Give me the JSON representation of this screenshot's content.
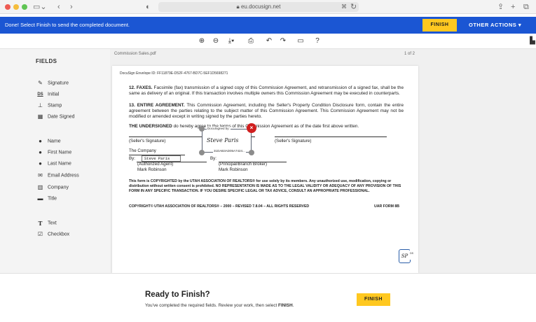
{
  "browser": {
    "url": "eu.docusign.net"
  },
  "banner": {
    "message": "Done! Select Finish to send the completed document.",
    "finish_label": "FINISH",
    "other_actions_label": "OTHER ACTIONS ▾"
  },
  "toolbar": {
    "icons": [
      "zoom-in-icon",
      "zoom-out-icon",
      "download-icon",
      "print-icon",
      "rotate-left-icon",
      "rotate-right-icon",
      "comment-icon",
      "help-icon"
    ]
  },
  "sidebar": {
    "title": "FIELDS",
    "items": [
      {
        "label": "Signature",
        "icon": "signature-icon"
      },
      {
        "label": "Initial",
        "icon": "initial-icon"
      },
      {
        "label": "Stamp",
        "icon": "stamp-icon"
      },
      {
        "label": "Date Signed",
        "icon": "calendar-icon"
      },
      {
        "label": "Name",
        "icon": "person-icon"
      },
      {
        "label": "First Name",
        "icon": "person-icon"
      },
      {
        "label": "Last Name",
        "icon": "person-icon"
      },
      {
        "label": "Email Address",
        "icon": "email-icon"
      },
      {
        "label": "Company",
        "icon": "company-icon"
      },
      {
        "label": "Title",
        "icon": "briefcase-icon"
      },
      {
        "label": "Text",
        "icon": "text-icon"
      },
      {
        "label": "Checkbox",
        "icon": "checkbox-icon"
      }
    ]
  },
  "document": {
    "name": "Commission Sales.pdf",
    "page_count": "1 of 2",
    "envelope_id": "DocuSign Envelope ID: FF11879E-D52F-4767-BD7C-5EF1D5698271",
    "para12_head": "12. FAXES.",
    "para12": "Facsimile (fax) transmission of a signed copy of this Commission Agreement, and retransmission of a signed fax, shall be the same as delivery of an original. If this transaction involves multiple owners this Commission Agreement may be executed in counterparts.",
    "para13_head": "13. ENTIRE AGREEMENT.",
    "para13": "This Commission Agreement, including the Seller's Property Condition Disclosure form, contain the entire agreement between the parties relating to the subject matter of this Commission Agreement. This Commission Agreement may not be modified or amended except in writing signed by the parties hereto.",
    "undersigned_head": "THE UNDERSIGNED",
    "undersigned": "do hereby agree to the terms of this Commission Agreement as of the date first above written.",
    "sellers_signature_left": "(Seller's Signature)",
    "sellers_signature_right": "(Seller's Signature)",
    "company": "The Company",
    "by_left": "By:",
    "by_right": "By:",
    "authorized_agent": "(Authorized Agent)",
    "principal_broker": "(Principal/Branch Broker)",
    "name_left": "Mark Robinson",
    "name_right": "Mark Robinson",
    "legal": "This form is COPYRIGHTED by the UTAH ASSOCIATION OF REALTORS® for use solely by its members. Any unauthorized use, modification, copying or distribution without written consent is prohibited. NO REPRESENTATION IS MADE AS TO THE LEGAL VALIDITY OR ADEQUACY OF ANY PROVISION OF THIS FORM IN ANY SPECIFIC TRANSACTION. IF YOU DESIRE SPECIFIC LEGAL OR TAX ADVICE, CONSULT AN APPROPRIATE PROFESSIONAL.",
    "copyright": "COPYRIGHT© UTAH ASSOCIATION OF REALTORS® – 2000 – REVISED 7.8.04 – ALL RIGHTS RESERVED",
    "form_code": "UAR FORM 8B",
    "signature_box": {
      "label": "DocuSigned by:",
      "signature": "Steve Paris",
      "envelope_code": "31DAB3AD05A7424..."
    },
    "name_field": "Steve Paris",
    "initials_tag": "DS",
    "initials": "SP"
  },
  "bottom_bar": {
    "title": "Ready to Finish?",
    "subtitle_prefix": "You've completed the required fields. Review your work, then select ",
    "subtitle_bold": "FINISH",
    "subtitle_suffix": ".",
    "finish_label": "FINISH"
  },
  "colors": {
    "banner_blue": "#1b56d3",
    "finish_yellow": "#ffc820",
    "close_red": "#d01f1f"
  }
}
